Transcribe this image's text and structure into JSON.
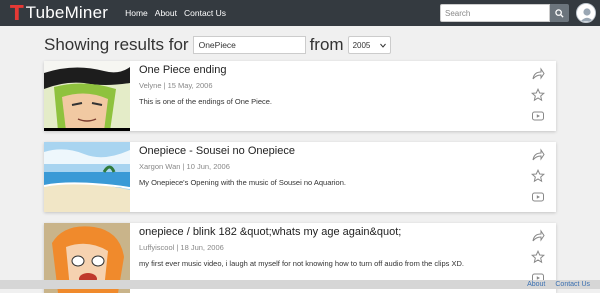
{
  "brand": {
    "logo_letter": "T",
    "name": "TubeMiner"
  },
  "nav": {
    "links": [
      "Home",
      "About",
      "Contact Us"
    ]
  },
  "search": {
    "placeholder": "Search",
    "icon": "search-icon"
  },
  "results": {
    "prefix": "Showing results for",
    "query": "OnePiece",
    "from_label": "from",
    "year": "2005"
  },
  "videos": [
    {
      "title": "One Piece ending",
      "meta": "Velyne | 15 May, 2006",
      "description": "This is one of the endings of One Piece."
    },
    {
      "title": "Onepiece - Sousei no Onepiece",
      "meta": "Xargon Wan | 10 Jun, 2006",
      "description": "My Onepiece's Opening with the music of Sousei no Aquarion."
    },
    {
      "title": "onepiece / blink 182 &quot;whats my age again&quot;",
      "meta": "Luffyiscool | 18 Jun, 2006",
      "description": "my first ever music video, i laugh at myself for not knowing how to turn off audio from the clips XD."
    }
  ],
  "footer": {
    "links": [
      "About",
      "Contact Us"
    ]
  },
  "colors": {
    "navbar": "#343a40",
    "logo_accent": "#e53935",
    "footer_link": "#3a6fb0"
  }
}
